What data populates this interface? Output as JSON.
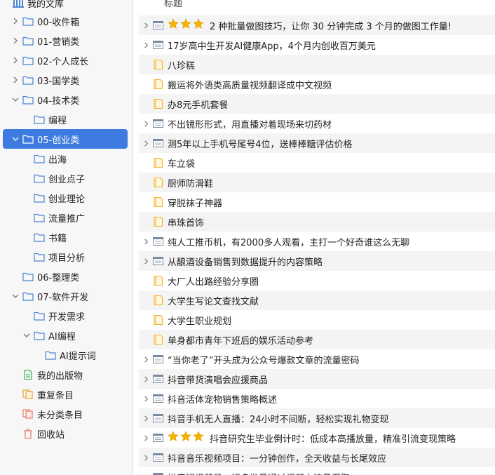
{
  "library": {
    "root_label": "我的文库",
    "items": [
      {
        "label": "00-收件箱",
        "icon": "folder-icon",
        "chevron": "right",
        "indent": 1
      },
      {
        "label": "01-营销类",
        "icon": "folder-icon",
        "chevron": "right",
        "indent": 1
      },
      {
        "label": "02-个人成长",
        "icon": "folder-icon",
        "chevron": "right",
        "indent": 1
      },
      {
        "label": "03-国学类",
        "icon": "folder-icon",
        "chevron": "right",
        "indent": 1
      },
      {
        "label": "04-技术类",
        "icon": "folder-icon",
        "chevron": "down",
        "indent": 1
      },
      {
        "label": "编程",
        "icon": "folder-icon",
        "chevron": "none",
        "indent": 2
      },
      {
        "label": "05-创业类",
        "icon": "folder-icon",
        "chevron": "down",
        "indent": 1,
        "selected": true
      },
      {
        "label": "出海",
        "icon": "folder-icon",
        "chevron": "none",
        "indent": 2
      },
      {
        "label": "创业点子",
        "icon": "folder-icon",
        "chevron": "none",
        "indent": 2
      },
      {
        "label": "创业理论",
        "icon": "folder-icon",
        "chevron": "none",
        "indent": 2
      },
      {
        "label": "流量推广",
        "icon": "folder-icon",
        "chevron": "none",
        "indent": 2
      },
      {
        "label": "书籍",
        "icon": "folder-icon",
        "chevron": "none",
        "indent": 2
      },
      {
        "label": "项目分析",
        "icon": "folder-icon",
        "chevron": "none",
        "indent": 2
      },
      {
        "label": "06-整理类",
        "icon": "folder-icon",
        "chevron": "none",
        "indent": 1
      },
      {
        "label": "07-软件开发",
        "icon": "folder-icon",
        "chevron": "down",
        "indent": 1
      },
      {
        "label": "开发需求",
        "icon": "folder-icon",
        "chevron": "none",
        "indent": 2
      },
      {
        "label": "AI编程",
        "icon": "folder-icon",
        "chevron": "down",
        "indent": 2
      },
      {
        "label": "AI提示词",
        "icon": "folder-icon",
        "chevron": "none",
        "indent": 3
      },
      {
        "label": "我的出版物",
        "icon": "publication-icon",
        "chevron": "none",
        "indent": 1
      },
      {
        "label": "重复条目",
        "icon": "duplicate-icon",
        "chevron": "none",
        "indent": 1
      },
      {
        "label": "未分类条目",
        "icon": "unfiled-icon",
        "chevron": "none",
        "indent": 1
      },
      {
        "label": "回收站",
        "icon": "trash-icon",
        "chevron": "none",
        "indent": 1
      }
    ]
  },
  "items_list": {
    "column_header": "标题",
    "rows": [
      {
        "title": "2 种批量做图技巧，让你 30 分钟完成 3 个月的做图工作量!",
        "type": "webpage",
        "expandable": true,
        "stars": 3
      },
      {
        "title": "17岁高中生开发AI健康App，4个月内创收百万美元",
        "type": "webpage",
        "expandable": true,
        "stars": 0
      },
      {
        "title": "八珍糕",
        "type": "note",
        "expandable": false,
        "stars": 0
      },
      {
        "title": "搬运将外语类高质量视频翻译成中文视频",
        "type": "note",
        "expandable": false,
        "stars": 0
      },
      {
        "title": "办8元手机套餐",
        "type": "note",
        "expandable": false,
        "stars": 0
      },
      {
        "title": "不出镜形形式，用直播对着现场来切药材",
        "type": "webpage",
        "expandable": true,
        "stars": 0
      },
      {
        "title": "测5年以上手机号尾号4位，送棒棒糖评估价格",
        "type": "webpage",
        "expandable": true,
        "stars": 0
      },
      {
        "title": "车立袋",
        "type": "note",
        "expandable": false,
        "stars": 0
      },
      {
        "title": "厨师防滑鞋",
        "type": "note",
        "expandable": false,
        "stars": 0
      },
      {
        "title": "穿脱袜子神器",
        "type": "note",
        "expandable": false,
        "stars": 0
      },
      {
        "title": "串珠首饰",
        "type": "note",
        "expandable": false,
        "stars": 0
      },
      {
        "title": "纯人工推币机，有2000多人观看，主打一个好奇谁这么无聊",
        "type": "webpage",
        "expandable": true,
        "stars": 0
      },
      {
        "title": "从酿酒设备销售到数据提升的内容策略",
        "type": "webpage",
        "expandable": true,
        "stars": 0
      },
      {
        "title": "大厂人出路经验分享圈",
        "type": "note",
        "expandable": false,
        "stars": 0
      },
      {
        "title": "大学生写论文查找文献",
        "type": "note",
        "expandable": false,
        "stars": 0
      },
      {
        "title": "大学生职业规划",
        "type": "note",
        "expandable": false,
        "stars": 0
      },
      {
        "title": "单身都市青年下班后的娱乐活动参考",
        "type": "note",
        "expandable": false,
        "stars": 0
      },
      {
        "title": "“当你老了”开头成为公众号爆款文章的流量密码",
        "type": "webpage",
        "expandable": true,
        "stars": 0
      },
      {
        "title": "抖音带货演唱会应援商品",
        "type": "webpage",
        "expandable": true,
        "stars": 0
      },
      {
        "title": "抖音活体宠物销售策略概述",
        "type": "webpage",
        "expandable": true,
        "stars": 0
      },
      {
        "title": "抖音手机无人直播：24小时不间断，轻松实现礼物变现",
        "type": "webpage",
        "expandable": true,
        "stars": 0
      },
      {
        "title": "抖音研究生毕业倒计时：低成本高播放量，精准引流变现策略",
        "type": "webpage",
        "expandable": true,
        "stars": 3
      },
      {
        "title": "抖音音乐视频项目：一分钟创作，全天收益与长尾效应",
        "type": "webpage",
        "expandable": true,
        "stars": 0
      },
      {
        "title": "抖音短视频号，行多批量通过视频内流量汇聚",
        "type": "webpage",
        "expandable": true,
        "stars": 0
      }
    ]
  },
  "colors": {
    "selected": "#3d7be0",
    "folder": "#4a86d4",
    "note": "#f0b429",
    "star": "#f5b301"
  }
}
